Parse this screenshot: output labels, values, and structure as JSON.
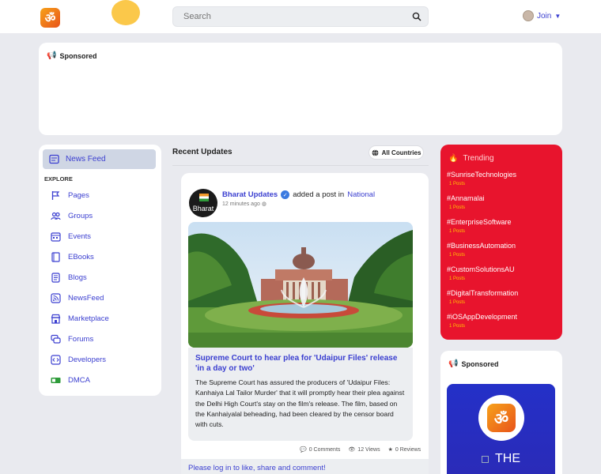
{
  "header": {
    "logo_glyph": "ॐ",
    "search_placeholder": "Search",
    "join_label": "Join"
  },
  "top_ad": {
    "label": "Sponsored"
  },
  "left_nav": {
    "active": "News Feed",
    "explore_label": "EXPLORE",
    "items": [
      {
        "label": "Pages",
        "icon": "flag-icon"
      },
      {
        "label": "Groups",
        "icon": "users-icon"
      },
      {
        "label": "Events",
        "icon": "calendar-icon"
      },
      {
        "label": "EBooks",
        "icon": "book-icon"
      },
      {
        "label": "Blogs",
        "icon": "document-icon"
      },
      {
        "label": "NewsFeed",
        "icon": "rss-icon"
      },
      {
        "label": "Marketplace",
        "icon": "store-icon"
      },
      {
        "label": "Forums",
        "icon": "chat-icon"
      },
      {
        "label": "Developers",
        "icon": "code-icon"
      },
      {
        "label": "DMCA",
        "icon": "dmca-icon"
      }
    ]
  },
  "feed": {
    "title": "Recent Updates",
    "filter_label": "All Countries",
    "post": {
      "author": "Bharat Updates",
      "avatar_text": "Bharat",
      "action": "added a post in",
      "category": "National",
      "time": "12 minutes ago",
      "headline": "Supreme Court to hear plea for 'Udaipur Files' release 'in a day or two'",
      "body": "The Supreme Court has assured the producers of 'Udaipur Files: Kanhaiya Lal Tailor Murder' that it will promptly hear their plea against the Delhi High Court's stay on the film's release. The film, based on the Kanhaiyalal beheading, had been cleared by the censor board with cuts.",
      "comments": "0 Comments",
      "views": "12 Views",
      "reviews": "0 Reviews"
    },
    "login_prompt": "Please log in to like, share and comment!"
  },
  "trending": {
    "title": "Trending",
    "tags": [
      {
        "tag": "#SunriseTechnologies",
        "count": "1 Posts"
      },
      {
        "tag": "#Annamalai",
        "count": "1 Posts"
      },
      {
        "tag": "#EnterpriseSoftware",
        "count": "1 Posts"
      },
      {
        "tag": "#BusinessAutomation",
        "count": "1 Posts"
      },
      {
        "tag": "#CustomSolutionsAU",
        "count": "1 Posts"
      },
      {
        "tag": "#DigitalTransformation",
        "count": "1 Posts"
      },
      {
        "tag": "#iOSAppDevelopment",
        "count": "1 Posts"
      }
    ]
  },
  "side_ad": {
    "label": "Sponsored",
    "ad_text": "THE",
    "logo_glyph": "ॐ"
  },
  "colors": {
    "accent": "#3b3fd0",
    "trending_bg": "#e8142d",
    "brand_orange": "#f7a21a"
  }
}
